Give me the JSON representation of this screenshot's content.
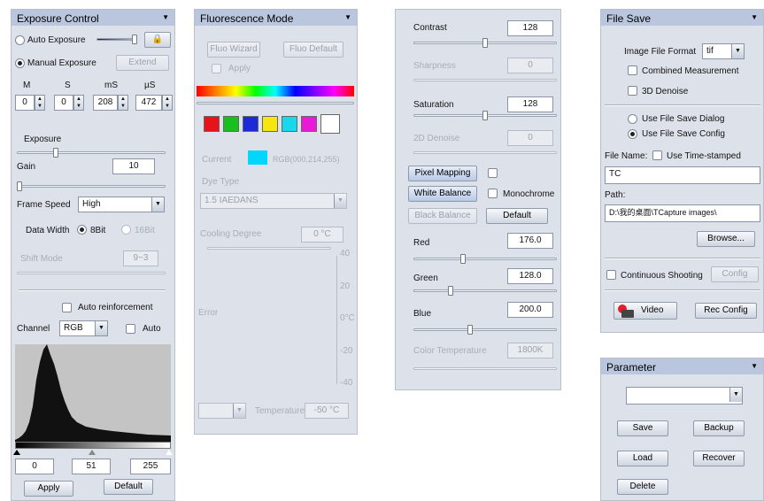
{
  "exposure": {
    "title": "Exposure Control",
    "auto_exposure_label": "Auto Exposure",
    "manual_exposure_label": "Manual Exposure",
    "extend_label": "Extend",
    "col_headers": [
      "M",
      "S",
      "mS",
      "µS"
    ],
    "time_values": [
      "0",
      "0",
      "208",
      "472"
    ],
    "exposure_label": "Exposure",
    "exposure_level": 0.25,
    "gain_label": "Gain",
    "gain_value": "10",
    "gain_level": 0.0,
    "frame_speed_label": "Frame Speed",
    "frame_speed_value": "High",
    "data_width_label": "Data Width",
    "bit8_label": "8Bit",
    "bit16_label": "16Bit",
    "shift_mode_label": "Shift Mode",
    "shift_mode_value": "9~3",
    "auto_reinforcement_label": "Auto reinforcement",
    "channel_label": "Channel",
    "channel_value": "RGB",
    "auto_label": "Auto",
    "level_low": "0",
    "level_mid": "51",
    "level_high": "255",
    "apply_label": "Apply",
    "default_label": "Default"
  },
  "fluorescence": {
    "title": "Fluorescence Mode",
    "fluo_wizard_label": "Fluo Wizard",
    "fluo_default_label": "Fluo Default",
    "apply_label": "Apply",
    "swatches": [
      "#e8131a",
      "#18c01e",
      "#1b2bd8",
      "#f5e60f",
      "#18d8ee",
      "#e81ad8",
      "#ffffff"
    ],
    "current_label": "Current",
    "current_color": "#00d6ff",
    "current_rgb": "RGB(000,214,255)",
    "dye_type_label": "Dye Type",
    "dye_value": "1.5 IAEDANS",
    "cooling_degree_label": "Cooling Degree",
    "cooling_value": "0 °C",
    "axis_ticks": [
      "40",
      "20",
      "0°C",
      "-20",
      "-40"
    ],
    "error_label": "Error",
    "temperature_label": "Temperature",
    "temperature_value": "-50 °C"
  },
  "color": {
    "contrast_label": "Contrast",
    "contrast_value": "128",
    "contrast_level": 0.5,
    "sharpness_label": "Sharpness",
    "sharpness_value": "0",
    "saturation_label": "Saturation",
    "saturation_value": "128",
    "saturation_level": 0.5,
    "denoise_label": "2D Denoise",
    "denoise_value": "0",
    "pixel_mapping_label": "Pixel Mapping",
    "white_balance_label": "White Balance",
    "monochrome_label": "Monochrome",
    "black_balance_label": "Black Balance",
    "default_label": "Default",
    "red_label": "Red",
    "red_value": "176.0",
    "red_level": 0.34,
    "green_label": "Green",
    "green_value": "128.0",
    "green_level": 0.25,
    "blue_label": "Blue",
    "blue_value": "200.0",
    "blue_level": 0.39,
    "color_temp_label": "Color Temperature",
    "color_temp_value": "1800K"
  },
  "filesave": {
    "title": "File Save",
    "format_label": "Image File Format",
    "format_value": "tif",
    "combined_label": "Combined Measurement",
    "denoise3d_label": "3D Denoise",
    "dialog_label": "Use File Save Dialog",
    "config_label": "Use File Save Config",
    "file_name_label": "File Name:",
    "timestamped_label": "Use Time-stamped",
    "file_name_value": "TC",
    "path_label": "Path:",
    "path_value": "D:\\我的桌面\\TCapture images\\",
    "browse_label": "Browse...",
    "continuous_label": "Continuous Shooting",
    "config_btn_label": "Config",
    "video_label": "Video",
    "rec_config_label": "Rec Config"
  },
  "parameter": {
    "title": "Parameter",
    "select_value": "",
    "save_label": "Save",
    "backup_label": "Backup",
    "load_label": "Load",
    "recover_label": "Recover",
    "delete_label": "Delete"
  }
}
